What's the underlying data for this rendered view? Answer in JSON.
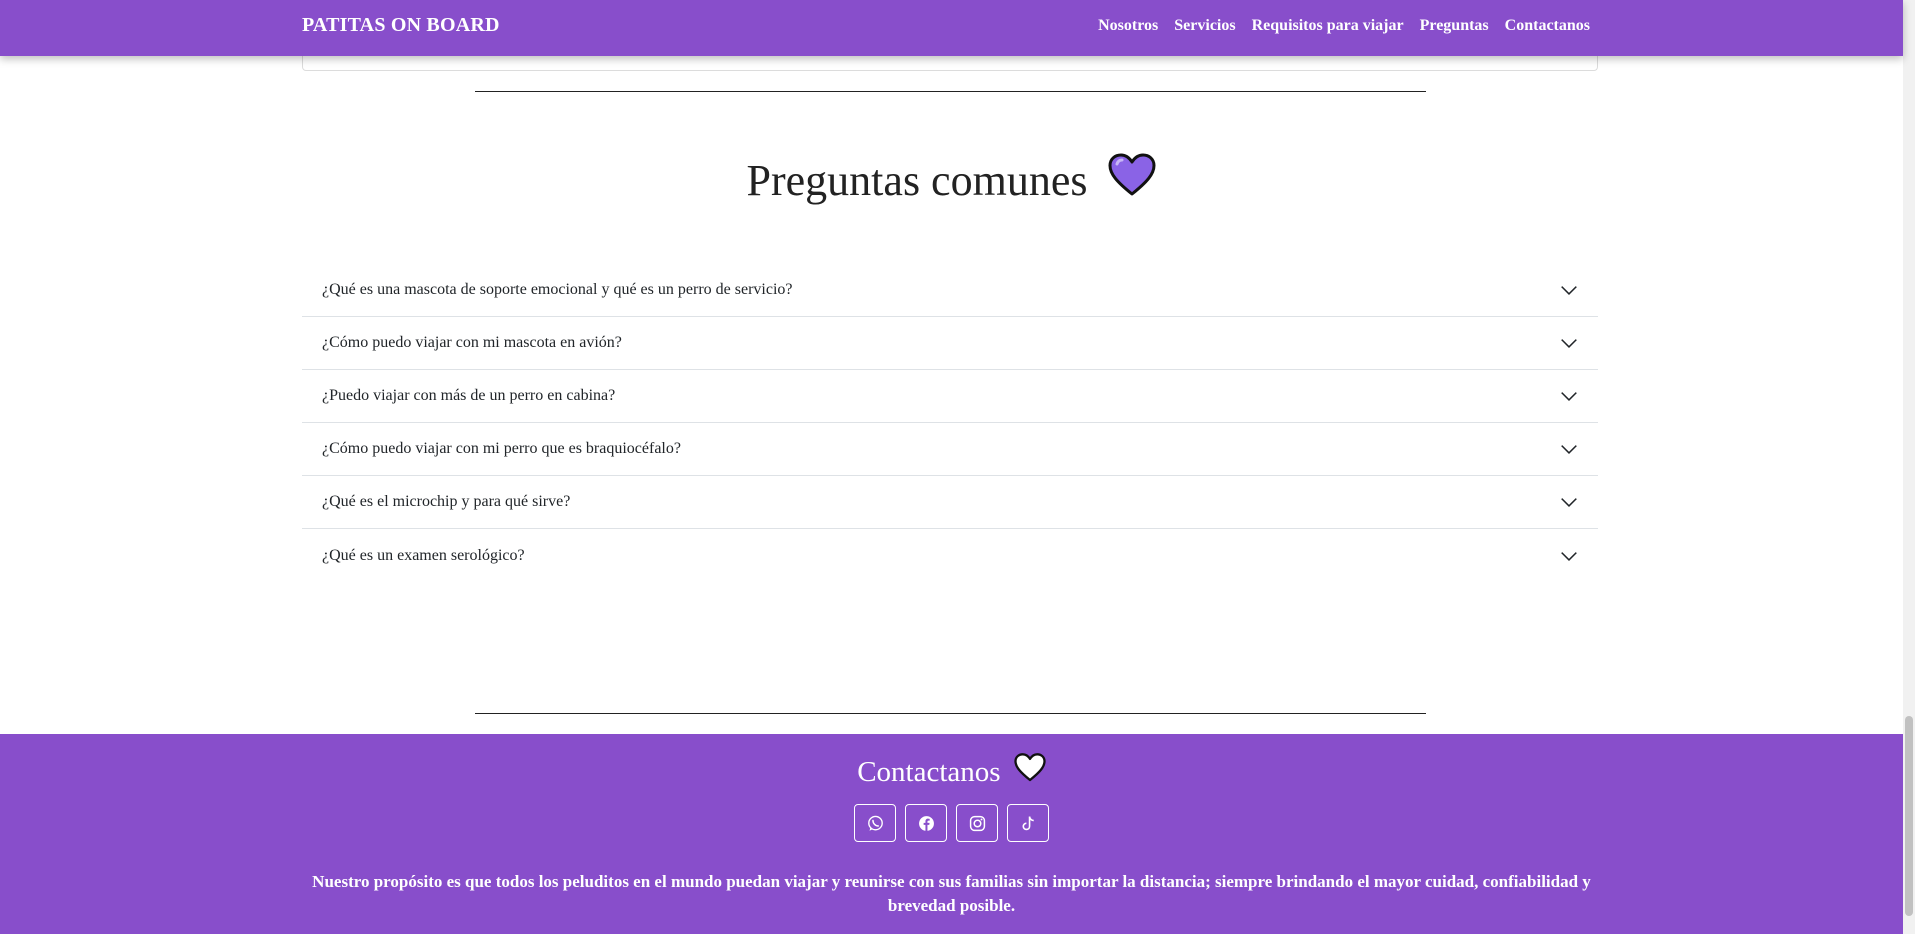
{
  "navbar": {
    "brand": "PATITAS ON BOARD",
    "links": [
      "Nosotros",
      "Servicios",
      "Requisitos para viajar",
      "Preguntas",
      "Contactanos"
    ]
  },
  "faq": {
    "title": "Preguntas comunes",
    "heart_color": "#8a63e6",
    "items": [
      "¿Qué es una mascota de soporte emocional y qué es un perro de servicio?",
      "¿Cómo puedo viajar con mi mascota en avión?",
      "¿Puedo viajar con más de un perro en cabina?",
      "¿Cómo puedo viajar con mi perro que es braquiocéfalo?",
      "¿Qué es el microchip y para qué sirve?",
      "¿Qué es un examen serológico?"
    ]
  },
  "footer": {
    "title": "Contactanos",
    "socials": [
      "whatsapp-icon",
      "facebook-icon",
      "instagram-icon",
      "tiktok-icon"
    ],
    "text": "Nuestro propósito es que todos los peluditos en el mundo puedan viajar y reunirse con sus familias sin importar la distancia; siempre brindando el mayor cuidad, confiabilidad y brevedad posible."
  },
  "colors": {
    "brand_purple": "#884ecb",
    "divider": "#222222"
  }
}
